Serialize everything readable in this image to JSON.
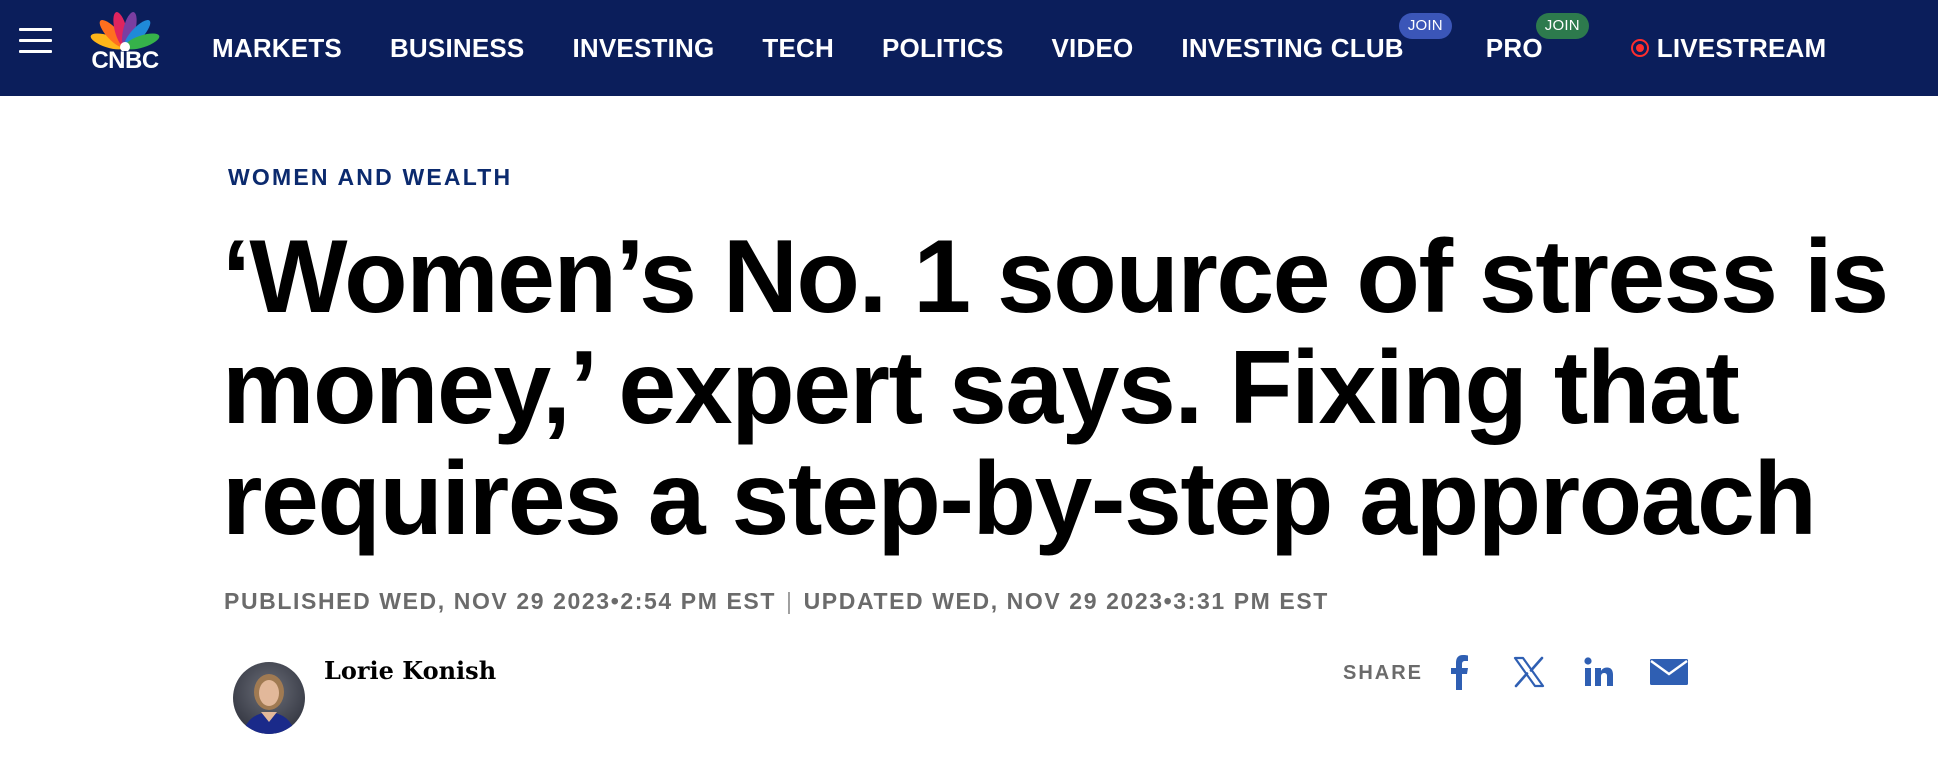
{
  "nav": {
    "logo_text": "CNBC",
    "items": [
      {
        "label": "MARKETS"
      },
      {
        "label": "BUSINESS"
      },
      {
        "label": "INVESTING"
      },
      {
        "label": "TECH"
      },
      {
        "label": "POLITICS"
      },
      {
        "label": "VIDEO"
      },
      {
        "label": "INVESTING CLUB",
        "badge": "JOIN"
      },
      {
        "label": "PRO",
        "badge": "JOIN"
      },
      {
        "label": "LIVESTREAM"
      }
    ],
    "icons": {
      "menu": "hamburger-menu-icon",
      "logo": "cnbc-peacock-logo",
      "live": "live-record-dot-icon"
    },
    "colors": {
      "bar": "#0b1e5b",
      "join_club_badge": "#3b56b8",
      "join_pro_badge": "#2d7a4d",
      "live": "#ff2d2d"
    }
  },
  "article": {
    "kicker": "WOMEN AND WEALTH",
    "headline": "‘Women’s No. 1 source of stress is money,’ expert says. Fixing that requires a step-by-step approach",
    "published": "PUBLISHED WED, NOV 29 2023•2:54 PM EST",
    "separator": "|",
    "updated": "UPDATED WED, NOV 29 2023•3:31 PM EST",
    "author": "Lorie Konish",
    "kicker_color": "#0b2a6e"
  },
  "share": {
    "label": "SHARE",
    "icons": [
      "facebook-icon",
      "x-twitter-icon",
      "linkedin-icon",
      "email-icon"
    ],
    "icon_color": "#2f5fb3"
  }
}
